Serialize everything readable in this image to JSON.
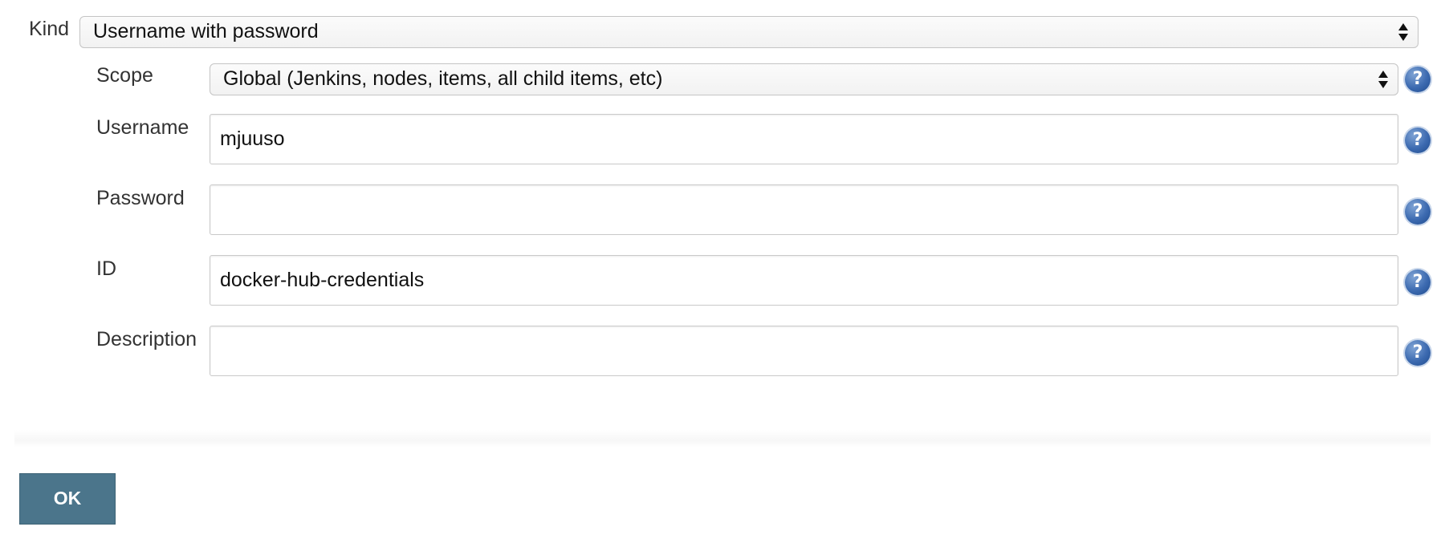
{
  "form": {
    "kind": {
      "label": "Kind",
      "selected": "Username with password"
    },
    "scope": {
      "label": "Scope",
      "selected": "Global (Jenkins, nodes, items, all child items, etc)"
    },
    "username": {
      "label": "Username",
      "value": "mjuuso"
    },
    "password": {
      "label": "Password",
      "value": ""
    },
    "id": {
      "label": "ID",
      "value": "docker-hub-credentials"
    },
    "description": {
      "label": "Description",
      "value": ""
    }
  },
  "help_icon": {
    "icon": "question-mark-help-icon",
    "glyph": "?"
  },
  "actions": {
    "ok_label": "OK"
  },
  "colors": {
    "ok_button": "#4b758b",
    "help_icon": "#3c6ab0"
  }
}
